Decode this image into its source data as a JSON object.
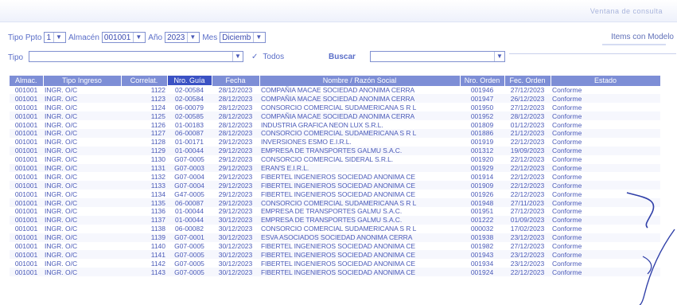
{
  "window": {
    "title": "Ventana de consulta"
  },
  "filters": {
    "tipo_ppto_label": "Tipo Ppto",
    "tipo_ppto_value": "1",
    "almacen_label": "Almacén",
    "almacen_value": "001001",
    "anio_label": "Año",
    "anio_value": "2023",
    "mes_label": "Mes",
    "mes_value": "Diciemb",
    "tipo_label": "Tipo",
    "tipo_value": "",
    "todos_label": "Todos",
    "todos_checked": true,
    "buscar_label": "Buscar",
    "buscar_value": "",
    "items_link": "Items con Modelo"
  },
  "table": {
    "columns": [
      "Almac.",
      "Tipo Ingreso",
      "Correlat.",
      "Nro. Guía",
      "Fecha",
      "Nombre / Razón Social",
      "Nro. Orden",
      "Fec. Orden",
      "Estado"
    ],
    "rows": [
      [
        "001001",
        "INGR. O/C",
        "1122",
        "02-00584",
        "28/12/2023",
        "COMPAÑIA MACAE SOCIEDAD ANONIMA CERRA",
        "001946",
        "27/12/2023",
        "Conforme"
      ],
      [
        "001001",
        "INGR. O/C",
        "1123",
        "02-00584",
        "28/12/2023",
        "COMPAÑIA MACAE SOCIEDAD ANONIMA CERRA",
        "001947",
        "26/12/2023",
        "Conforme"
      ],
      [
        "001001",
        "INGR. O/C",
        "1124",
        "06-00079",
        "28/12/2023",
        "CONSORCIO COMERCIAL SUDAMERICANA S R L",
        "001950",
        "27/12/2023",
        "Conforme"
      ],
      [
        "001001",
        "INGR. O/C",
        "1125",
        "02-00585",
        "28/12/2023",
        "COMPAÑIA MACAE SOCIEDAD ANONIMA CERRA",
        "001952",
        "28/12/2023",
        "Conforme"
      ],
      [
        "001001",
        "INGR. O/C",
        "1126",
        "01-00183",
        "28/12/2023",
        "INDUSTRIA GRAFICA NEON LUX S.R.L.",
        "001809",
        "01/12/2023",
        "Conforme"
      ],
      [
        "001001",
        "INGR. O/C",
        "1127",
        "06-00087",
        "28/12/2023",
        "CONSORCIO COMERCIAL SUDAMERICANA S R L",
        "001886",
        "21/12/2023",
        "Conforme"
      ],
      [
        "001001",
        "INGR. O/C",
        "1128",
        "01-00171",
        "29/12/2023",
        "INVERSIONES ESMO E.I.R.L.",
        "001919",
        "22/12/2023",
        "Conforme"
      ],
      [
        "001001",
        "INGR. O/C",
        "1129",
        "01-00044",
        "29/12/2023",
        "EMPRESA DE TRANSPORTES GALMU S.A.C.",
        "001312",
        "19/09/2023",
        "Conforme"
      ],
      [
        "001001",
        "INGR. O/C",
        "1130",
        "G07-0005",
        "29/12/2023",
        "CONSORCIO COMERCIAL SIDERAL S.R.L.",
        "001920",
        "22/12/2023",
        "Conforme"
      ],
      [
        "001001",
        "INGR. O/C",
        "1131",
        "G07-0003",
        "29/12/2023",
        "ERAN'S E.I.R.L.",
        "001929",
        "22/12/2023",
        "Conforme"
      ],
      [
        "001001",
        "INGR. O/C",
        "1132",
        "G07-0004",
        "29/12/2023",
        "FIBERTEL INGENIEROS SOCIEDAD ANONIMA CE",
        "001914",
        "22/12/2023",
        "Conforme"
      ],
      [
        "001001",
        "INGR. O/C",
        "1133",
        "G07-0004",
        "29/12/2023",
        "FIBERTEL INGENIEROS SOCIEDAD ANONIMA CE",
        "001909",
        "22/12/2023",
        "Conforme"
      ],
      [
        "001001",
        "INGR. O/C",
        "1134",
        "G47-0005",
        "29/12/2023",
        "FIBERTEL INGENIEROS SOCIEDAD ANONIMA CE",
        "001926",
        "22/12/2023",
        "Conforme"
      ],
      [
        "001001",
        "INGR. O/C",
        "1135",
        "06-00087",
        "29/12/2023",
        "CONSORCIO COMERCIAL SUDAMERICANA S R L",
        "001948",
        "27/11/2023",
        "Conforme"
      ],
      [
        "001001",
        "INGR. O/C",
        "1136",
        "01-00044",
        "29/12/2023",
        "EMPRESA DE TRANSPORTES GALMU S.A.C.",
        "001951",
        "27/12/2023",
        "Conforme"
      ],
      [
        "001001",
        "INGR. O/C",
        "1137",
        "01-00044",
        "30/12/2023",
        "EMPRESA DE TRANSPORTES GALMU S.A.C.",
        "001222",
        "01/09/2023",
        "Conforme"
      ],
      [
        "001001",
        "INGR. O/C",
        "1138",
        "06-00082",
        "30/12/2023",
        "CONSORCIO COMERCIAL SUDAMERICANA S R L",
        "000032",
        "17/02/2023",
        "Conforme"
      ],
      [
        "001001",
        "INGR. O/C",
        "1139",
        "G07-0001",
        "30/12/2023",
        "ESVA ASOCIADOS SOCIEDAD ANONIMA CERRA",
        "001938",
        "23/12/2023",
        "Conforme"
      ],
      [
        "001001",
        "INGR. O/C",
        "1140",
        "G07-0005",
        "30/12/2023",
        "FIBERTEL INGENIEROS SOCIEDAD ANONIMA CE",
        "001982",
        "27/12/2023",
        "Conforme"
      ],
      [
        "001001",
        "INGR. O/C",
        "1141",
        "G07-0005",
        "30/12/2023",
        "FIBERTEL INGENIEROS SOCIEDAD ANONIMA CE",
        "001943",
        "23/12/2023",
        "Conforme"
      ],
      [
        "001001",
        "INGR. O/C",
        "1142",
        "G07-0005",
        "30/12/2023",
        "FIBERTEL INGENIEROS SOCIEDAD ANONIMA CE",
        "001934",
        "23/12/2023",
        "Conforme"
      ],
      [
        "001001",
        "INGR. O/C",
        "1143",
        "G07-0005",
        "30/12/2023",
        "FIBERTEL INGENIEROS SOCIEDAD ANONIMA CE",
        "001924",
        "22/12/2023",
        "Conforme"
      ]
    ]
  },
  "colors": {
    "header_bg": "#7d8ed6",
    "selected_header_bg": "#3b52c4",
    "text": "#4a5ab8",
    "annotation_ink": "#2f3fa8"
  }
}
